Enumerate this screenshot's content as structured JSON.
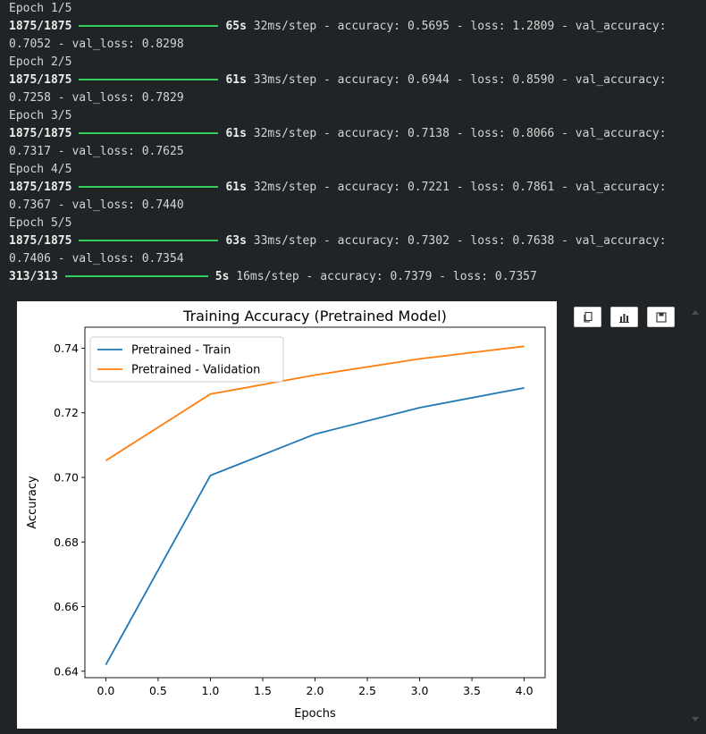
{
  "log": [
    {
      "type": "text",
      "text": "Epoch 1/5"
    },
    {
      "type": "progress",
      "steps": "1875/1875",
      "time": "65s",
      "rest": " 32ms/step - accuracy: 0.5695 - loss: 1.2809 - val_accuracy:"
    },
    {
      "type": "text",
      "text": "0.7052 - val_loss: 0.8298"
    },
    {
      "type": "text",
      "text": "Epoch 2/5"
    },
    {
      "type": "progress",
      "steps": "1875/1875",
      "time": "61s",
      "rest": " 33ms/step - accuracy: 0.6944 - loss: 0.8590 - val_accuracy:"
    },
    {
      "type": "text",
      "text": "0.7258 - val_loss: 0.7829"
    },
    {
      "type": "text",
      "text": "Epoch 3/5"
    },
    {
      "type": "progress",
      "steps": "1875/1875",
      "time": "61s",
      "rest": " 32ms/step - accuracy: 0.7138 - loss: 0.8066 - val_accuracy:"
    },
    {
      "type": "text",
      "text": "0.7317 - val_loss: 0.7625"
    },
    {
      "type": "text",
      "text": "Epoch 4/5"
    },
    {
      "type": "progress",
      "steps": "1875/1875",
      "time": "61s",
      "rest": " 32ms/step - accuracy: 0.7221 - loss: 0.7861 - val_accuracy:"
    },
    {
      "type": "text",
      "text": "0.7367 - val_loss: 0.7440"
    },
    {
      "type": "text",
      "text": "Epoch 5/5"
    },
    {
      "type": "progress",
      "steps": "1875/1875",
      "time": "63s",
      "rest": " 33ms/step - accuracy: 0.7302 - loss: 0.7638 - val_accuracy:"
    },
    {
      "type": "text",
      "text": "0.7406 - val_loss: 0.7354"
    },
    {
      "type": "progress",
      "steps": "313/313",
      "time": "5s",
      "rest": " 16ms/step - accuracy: 0.7379 - loss: 0.7357",
      "short": true
    }
  ],
  "colors": {
    "progress": "#2fce5a",
    "train": "#1f77b4",
    "validation": "#ff7f0e"
  },
  "toolbar": [
    {
      "name": "copy-icon"
    },
    {
      "name": "chart-icon"
    },
    {
      "name": "save-icon"
    }
  ],
  "chart_data": {
    "type": "line",
    "title": "Training Accuracy (Pretrained Model)",
    "xlabel": "Epochs",
    "ylabel": "Accuracy",
    "x": [
      0,
      1,
      2,
      3,
      4
    ],
    "xlim": [
      -0.2,
      4.2
    ],
    "ylim": [
      0.638,
      0.7465
    ],
    "xticks": [
      "0.0",
      "0.5",
      "1.0",
      "1.5",
      "2.0",
      "2.5",
      "3.0",
      "3.5",
      "4.0"
    ],
    "yticks": [
      "0.64",
      "0.66",
      "0.68",
      "0.70",
      "0.72",
      "0.74"
    ],
    "legend": "top-left",
    "grid": false,
    "series": [
      {
        "name": "Pretrained - Train",
        "color": "#1f77b4",
        "values": [
          0.642,
          0.7006,
          0.7134,
          0.7216,
          0.7277
        ]
      },
      {
        "name": "Pretrained - Validation",
        "color": "#ff7f0e",
        "values": [
          0.7052,
          0.7258,
          0.7317,
          0.7367,
          0.7406
        ]
      }
    ]
  }
}
